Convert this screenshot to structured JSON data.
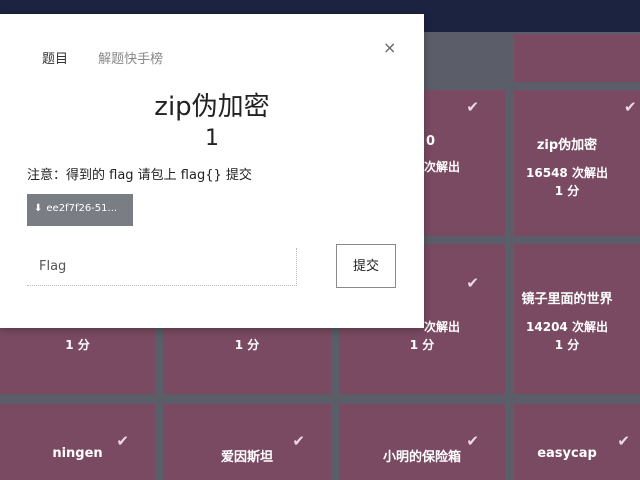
{
  "modal": {
    "tabs": [
      "题目",
      "解题快手榜"
    ],
    "close_icon": "×",
    "title": "zip伪加密",
    "points": "1",
    "note": "注意：得到的 flag 请包上 flag{} 提交",
    "file_button": "ee2f7f26-51...",
    "download_icon": "⬇",
    "flag_placeholder": "Flag",
    "submit_label": "提交"
  },
  "tiles": {
    "r1_c3_name": "0",
    "r1_c3_solves": "次解出",
    "r1_c4_name": "zip伪加密",
    "r1_c4_solves": "16548 次解出",
    "r1_c4_pts": "1 分",
    "r2_c1_pts": "1 分",
    "r2_c2_pts": "1 分",
    "r2_c3_solves": "次解出",
    "r2_c3_pts": "1 分",
    "r2_c4_name": "镜子里面的世界",
    "r2_c4_solves": "14204 次解出",
    "r2_c4_pts": "1 分",
    "r3_c1_name": "ningen",
    "r3_c2_name": "爱因斯坦",
    "r3_c3_name": "小明的保险箱",
    "r3_c4_name": "easycap",
    "check_icon": "✔"
  },
  "colors": {
    "tile": "#7a4a62",
    "topbar": "#1c2340",
    "file_button": "#7b7d85"
  }
}
